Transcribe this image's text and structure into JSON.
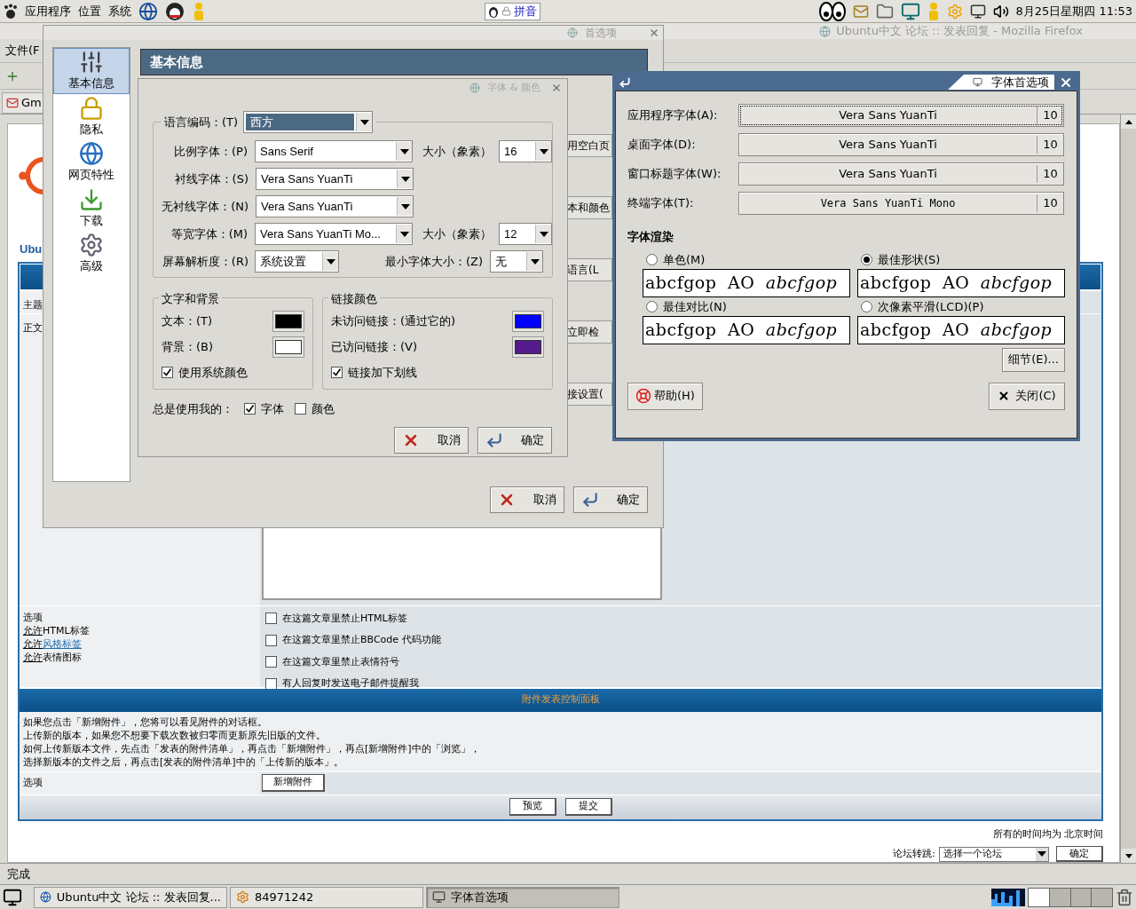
{
  "top_panel": {
    "menus": [
      "应用程序",
      "位置",
      "系统"
    ],
    "ime": "拼音",
    "clock": "8月25日星期四 11:53"
  },
  "browser": {
    "title": "Ubuntu中文 论坛 :: 发表回复 - Mozilla Firefox",
    "menu": "文件(F",
    "tab": "Gm",
    "site_title": "Ubu",
    "row_labels": [
      "主题",
      "正文"
    ],
    "options": {
      "label": "选项",
      "permissions": [
        {
          "link": "允许",
          "text": "HTML标签",
          "text_is_link": false
        },
        {
          "link": "允许",
          "text": "风格标签",
          "text_is_link": true
        },
        {
          "link": "允许",
          "text": "表情图标",
          "text_is_link": false
        }
      ],
      "checkboxes": [
        {
          "label": "在这篇文章里禁止HTML标签",
          "checked": false
        },
        {
          "label": "在这篇文章里禁止BBCode 代码功能",
          "checked": false
        },
        {
          "label": "在这篇文章里禁止表情符号",
          "checked": false
        },
        {
          "label": "有人回复时发送电子邮件提醒我",
          "checked": false
        }
      ]
    },
    "attachments": {
      "title": "附件发表控制面板",
      "lines": [
        "如果您点击「新增附件」，您将可以看见附件的对话框。",
        "上传新的版本，如果您不想要下载次数被归零而更新原先旧版的文件。",
        "如何上传新版本文件，先点击「发表的附件清单」，再点击「新增附件」，再点[新增附件]中的「浏览」，",
        "选择新版本的文件之后，再点击[发表的附件清单]中的「上传新的版本」。"
      ],
      "option_label": "选项",
      "add_button": "新增附件"
    },
    "submit_buttons": [
      "预览",
      "提交"
    ],
    "timezone": "所有的时间均为 北京时间",
    "jump": {
      "label": "论坛转跳:",
      "value": "选择一个论坛",
      "button": "确定"
    },
    "status": "完成"
  },
  "preferences": {
    "title": "首选项",
    "categories": [
      {
        "label": "基本信息",
        "selected": true
      },
      {
        "label": "隐私",
        "selected": false
      },
      {
        "label": "网页特性",
        "selected": false
      },
      {
        "label": "下载",
        "selected": false
      },
      {
        "label": "高级",
        "selected": false
      }
    ],
    "header": "基本信息",
    "behind_buttons": [
      "用空白页",
      "本和颜色",
      "语言(L",
      "立即检",
      "接设置("
    ],
    "buttons": [
      "取消",
      "确定"
    ]
  },
  "fonts_colors": {
    "title": "字体 & 颜色",
    "encoding": {
      "label": "语言编码：(T)",
      "value": "西方"
    },
    "font_rows": [
      {
        "label": "比例字体：(P)",
        "value": "Sans Serif",
        "size_label": "大小（象素）",
        "size": "16"
      },
      {
        "label": "衬线字体：(S)",
        "value": "Vera Sans YuanTi"
      },
      {
        "label": "无衬线字体：(N)",
        "value": "Vera Sans YuanTi"
      },
      {
        "label": "等宽字体：(M)",
        "value": "Vera Sans YuanTi Mo...",
        "size_label": "大小（象素）",
        "size": "12"
      }
    ],
    "resolution": {
      "label": "屏幕解析度：(R)",
      "value": "系统设置",
      "min_label": "最小字体大小：(Z)",
      "min_value": "无"
    },
    "text_group": {
      "title": "文字和背景",
      "colors": [
        {
          "label": "文本：(T)",
          "color": "#000000"
        },
        {
          "label": "背景：(B)",
          "color": "#ffffff"
        }
      ],
      "checkbox": {
        "label": "使用系统颜色",
        "checked": true
      }
    },
    "link_group": {
      "title": "链接颜色",
      "colors": [
        {
          "label": "未访问链接：(通过它的)",
          "color": "#0000ff"
        },
        {
          "label": "已访问链接：(V)",
          "color": "#551a8b"
        }
      ],
      "checkbox": {
        "label": "链接加下划线",
        "checked": true
      }
    },
    "always_use": {
      "label": "总是使用我的：",
      "options": [
        {
          "label": "字体",
          "checked": true
        },
        {
          "label": "颜色",
          "checked": false
        }
      ]
    },
    "buttons": [
      "取消",
      "确定"
    ]
  },
  "font_prefs": {
    "title": "字体首选项",
    "fonts": [
      {
        "label": "应用程序字体(A):",
        "font": "Vera Sans YuanTi",
        "size": "10",
        "mono": false,
        "focused": true
      },
      {
        "label": "桌面字体(D):",
        "font": "Vera Sans YuanTi",
        "size": "10",
        "mono": false,
        "focused": false
      },
      {
        "label": "窗口标题字体(W):",
        "font": "Vera Sans YuanTi",
        "size": "10",
        "mono": false,
        "focused": false
      },
      {
        "label": "终端字体(T):",
        "font": "Vera Sans YuanTi Mono",
        "size": "10",
        "mono": true,
        "focused": false
      }
    ],
    "rendering_title": "字体渲染",
    "rendering": [
      {
        "label": "单色(M)",
        "selected": false,
        "sample": "abcfgop AO *abcfgop*"
      },
      {
        "label": "最佳形状(S)",
        "selected": true,
        "sample": "abcfgop AO *abcfgop*"
      },
      {
        "label": "最佳对比(N)",
        "selected": false,
        "sample": "abcfgop AO *abcfgop*"
      },
      {
        "label": "次像素平滑(LCD)(P)",
        "selected": false,
        "sample": "abcfgop AO *abcfgop*"
      }
    ],
    "details_button": "细节(E)...",
    "help_button": "帮助(H)",
    "close_button": "关闭(C)"
  },
  "taskbar": {
    "tasks": [
      {
        "label": "Ubuntu中文 论坛 :: 发表回复...",
        "selected": false
      },
      {
        "label": "84971242",
        "selected": false
      },
      {
        "label": "字体首选项",
        "selected": true
      }
    ]
  }
}
